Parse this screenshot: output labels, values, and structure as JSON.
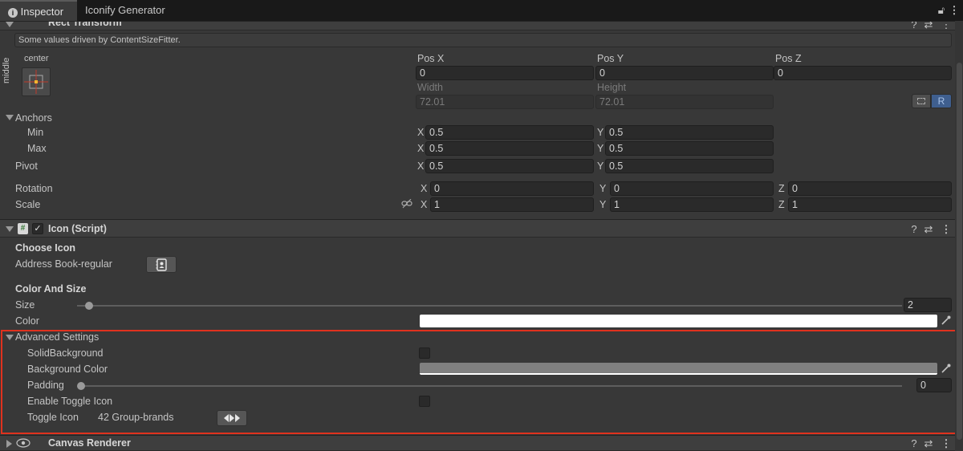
{
  "tabs": [
    {
      "label": "Inspector"
    },
    {
      "label": "Iconify Generator"
    }
  ],
  "rect_transform": {
    "title": "Rect Transform",
    "info": "Some values driven by ContentSizeFitter.",
    "anchor_preset": {
      "horizontal": "center",
      "vertical": "middle"
    },
    "pos_x_label": "Pos X",
    "pos_y_label": "Pos Y",
    "pos_z_label": "Pos Z",
    "pos_x": "0",
    "pos_y": "0",
    "pos_z": "0",
    "width_label": "Width",
    "height_label": "Height",
    "width": "72.01",
    "height": "72.01",
    "r_button": "R",
    "anchors_label": "Anchors",
    "min_label": "Min",
    "max_label": "Max",
    "pivot_label": "Pivot",
    "min_x": "0.5",
    "min_y": "0.5",
    "max_x": "0.5",
    "max_y": "0.5",
    "pivot_x": "0.5",
    "pivot_y": "0.5",
    "rotation_label": "Rotation",
    "scale_label": "Scale",
    "rot_x": "0",
    "rot_y": "0",
    "rot_z": "0",
    "scale_x": "1",
    "scale_y": "1",
    "scale_z": "1"
  },
  "icon_script": {
    "title": "Icon (Script)",
    "choose_icon_header": "Choose Icon",
    "icon_name": "Address Book-regular",
    "color_size_header": "Color And Size",
    "size_label": "Size",
    "size_value": "2",
    "color_label": "Color",
    "color_value": "#ffffff",
    "advanced_label": "Advanced Settings",
    "solid_bg_label": "SolidBackground",
    "bg_color_label": "Background Color",
    "bg_color_value": "#808080",
    "padding_label": "Padding",
    "padding_value": "0",
    "enable_toggle_label": "Enable Toggle Icon",
    "toggle_icon_label": "Toggle Icon",
    "toggle_icon_name": "42 Group-brands"
  },
  "canvas_renderer": {
    "title": "Canvas Renderer"
  },
  "highlight_color": "#e0321e",
  "axes": {
    "x": "X",
    "y": "Y",
    "z": "Z"
  }
}
